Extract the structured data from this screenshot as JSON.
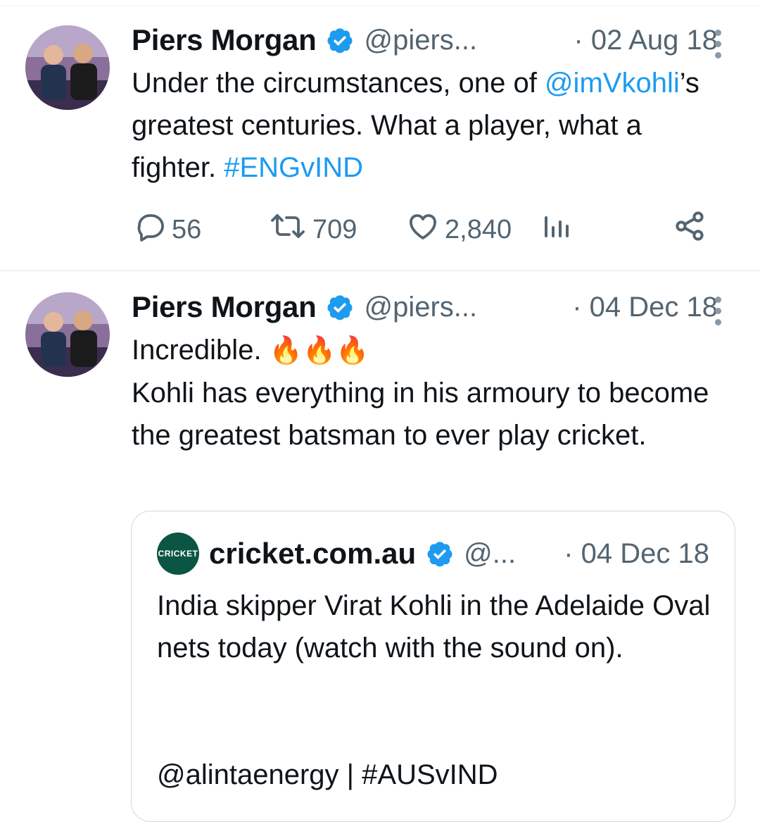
{
  "tweets": [
    {
      "author_name": "Piers Morgan",
      "handle": "@piers...",
      "date": "· 02 Aug 18",
      "text_before_mention": "Under the circumstances, one of ",
      "mention": "@imVkohli",
      "text_after_mention": "’s greatest centuries. What a player, what a fighter. ",
      "hashtag": "#ENGvIND",
      "stats": {
        "replies": "56",
        "retweets": "709",
        "likes": "2,840"
      },
      "icons": [
        "reply-icon",
        "retweet-icon",
        "like-icon",
        "views-icon",
        "share-icon"
      ]
    },
    {
      "author_name": "Piers Morgan",
      "handle": "@piers...",
      "date": "· 04 Dec 18",
      "line1": "Incredible. ",
      "emoji": "🔥🔥🔥",
      "line2": "Kohli has everything in his armoury to become the greatest batsman to ever play cricket.",
      "quote": {
        "author_name": "cricket.com.au",
        "avatar_text": "CRICKET",
        "handle": "@...",
        "date": "· 04 Dec 18",
        "text": "India skipper Virat Kohli in the Adelaide Oval nets today (watch with the sound on).",
        "tags": "@alintaenergy | #AUSvIND"
      }
    }
  ],
  "colors": {
    "link": "#1d9bf0",
    "verified": "#1d9bf0",
    "muted": "#536471"
  }
}
